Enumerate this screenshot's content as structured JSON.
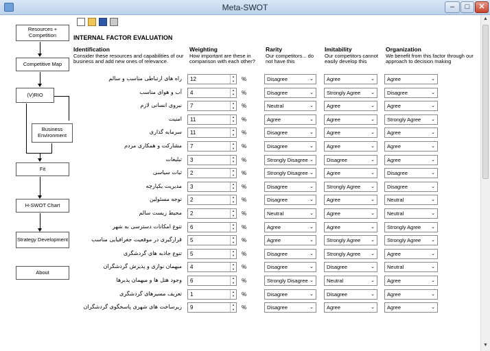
{
  "window": {
    "title": "Meta-SWOT"
  },
  "sidebar": [
    {
      "label": "Resources + Competition"
    },
    {
      "label": "Competitive Map"
    },
    {
      "label": "(V)RIO"
    },
    {
      "label": "Business Environment"
    },
    {
      "label": "Fit"
    },
    {
      "label": "H-SWOT Chart"
    },
    {
      "label": "Strategy Development"
    },
    {
      "label": "About"
    }
  ],
  "section_title": "INTERNAL FACTOR EVALUATION",
  "columns": {
    "identification": {
      "title": "Identification",
      "desc": "Consider these resources and capabilities of our business and add new ones of relevance."
    },
    "weighting": {
      "title": "Weighting",
      "desc": "How important are these in comparison with each other?"
    },
    "rarity": {
      "title": "Rarity",
      "desc": "Our competitors... do not have this"
    },
    "imitability": {
      "title": "Imitability",
      "desc": "Our competitors cannot easily develop this"
    },
    "organization": {
      "title": "Organization",
      "desc": "We benefit from this factor through our approach to decision making"
    }
  },
  "percent_sign": "%",
  "rows": [
    {
      "factor": "راه های ارتباطی مناسب و سالم",
      "weight": "12",
      "rarity": "Disagree",
      "imitability": "Agree",
      "organization": "Agree"
    },
    {
      "factor": "آب و هوای مناسب",
      "weight": "4",
      "rarity": "Disagree",
      "imitability": "Strongly Agree",
      "organization": "Disagree"
    },
    {
      "factor": "نیروی انسانی لازم",
      "weight": "7",
      "rarity": "Neutral",
      "imitability": "Agree",
      "organization": "Agree"
    },
    {
      "factor": "امنیت",
      "weight": "11",
      "rarity": "Agree",
      "imitability": "Agree",
      "organization": "Strongly Agree"
    },
    {
      "factor": "سرمایه گذاری",
      "weight": "11",
      "rarity": "Disagree",
      "imitability": "Agree",
      "organization": "Agree"
    },
    {
      "factor": "مشارکت و همکاری مردم",
      "weight": "7",
      "rarity": "Disagree",
      "imitability": "Agree",
      "organization": "Agree"
    },
    {
      "factor": "تبلیغات",
      "weight": "3",
      "rarity": "Strongly Disagree",
      "imitability": "Disagree",
      "organization": "Agree"
    },
    {
      "factor": "ثبات سیاسی",
      "weight": "2",
      "rarity": "Strongly Disagree",
      "imitability": "Agree",
      "organization": "Disagree"
    },
    {
      "factor": "مدیریت یکپارچه",
      "weight": "3",
      "rarity": "Disagree",
      "imitability": "Strongly Agree",
      "organization": "Disagree"
    },
    {
      "factor": "توجه مسئولین",
      "weight": "2",
      "rarity": "Disagree",
      "imitability": "Agree",
      "organization": "Neutral"
    },
    {
      "factor": "محیط زیست سالم",
      "weight": "2",
      "rarity": "Neutral",
      "imitability": "Agree",
      "organization": "Neutral"
    },
    {
      "factor": "تنوع امکانات دسترسی به شهر",
      "weight": "6",
      "rarity": "Agree",
      "imitability": "Agree",
      "organization": "Strongly Agree"
    },
    {
      "factor": "قرارگیری در موقعیت جغرافیایی مناسب",
      "weight": "5",
      "rarity": "Agree",
      "imitability": "Strongly Agree",
      "organization": "Strongly Agree"
    },
    {
      "factor": "تنوع جاذبه های گردشگری",
      "weight": "5",
      "rarity": "Disagree",
      "imitability": "Strongly Agree",
      "organization": "Agree"
    },
    {
      "factor": "میهمان نوازی و پذیرش گردشگران",
      "weight": "4",
      "rarity": "Disagree",
      "imitability": "Disagree",
      "organization": "Neutral"
    },
    {
      "factor": "وجود هتل ها و میهمان پذیرها",
      "weight": "6",
      "rarity": "Strongly Disagree",
      "imitability": "Neutral",
      "organization": "Agree"
    },
    {
      "factor": "تعریف مسیرهای گردشگری",
      "weight": "1",
      "rarity": "Disagree",
      "imitability": "Disagree",
      "organization": "Agree"
    },
    {
      "factor": "زیرساخت های شهری پاسخگوی گردشگران",
      "weight": "9",
      "rarity": "Disagree",
      "imitability": "Agree",
      "organization": "Agree"
    }
  ]
}
